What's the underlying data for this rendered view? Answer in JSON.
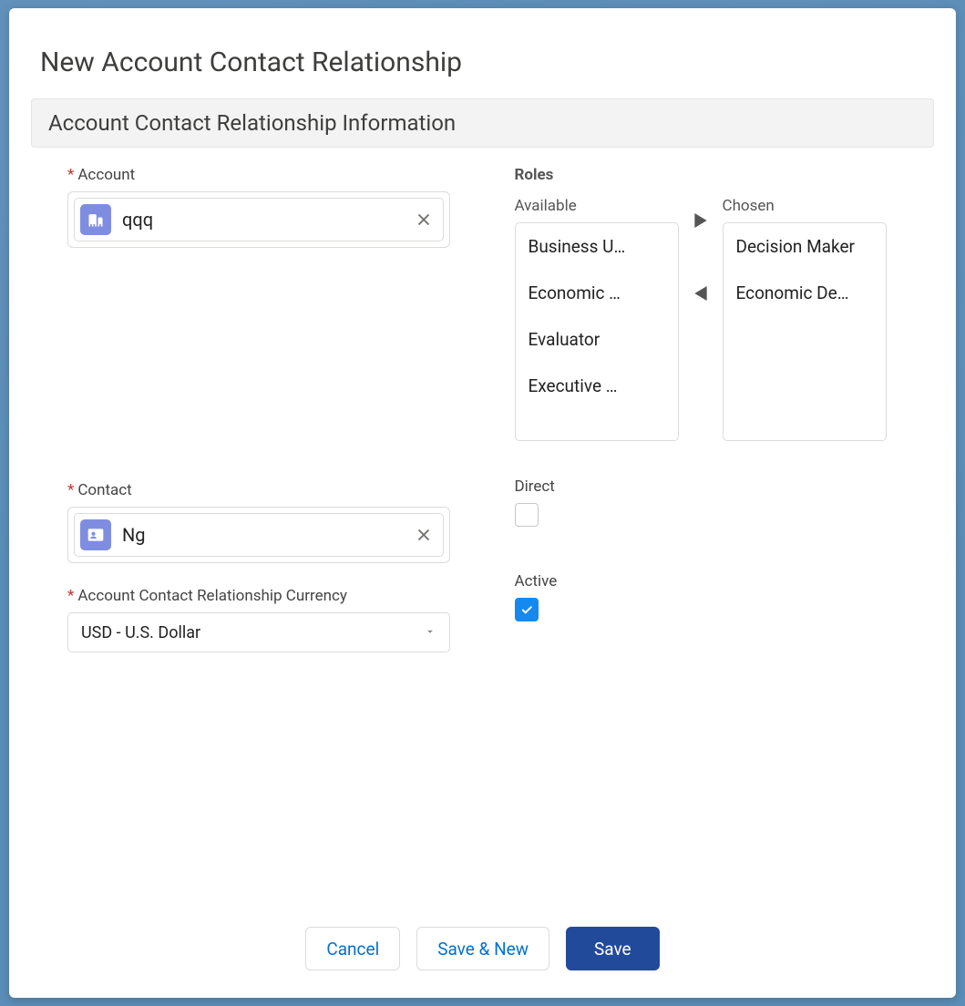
{
  "modal": {
    "title": "New Account Contact Relationship",
    "section_header": "Account Contact Relationship Information"
  },
  "fields": {
    "account": {
      "label": "Account",
      "value": "qqq",
      "required": true
    },
    "contact": {
      "label": "Contact",
      "value": "Ng",
      "required": true
    },
    "currency": {
      "label": "Account Contact Relationship Currency",
      "value": "USD - U.S. Dollar",
      "required": true
    },
    "roles": {
      "label": "Roles",
      "available_label": "Available",
      "chosen_label": "Chosen",
      "available": [
        "Business U…",
        "Economic …",
        "Evaluator",
        "Executive …"
      ],
      "chosen": [
        "Decision Maker",
        "Economic De…"
      ]
    },
    "direct": {
      "label": "Direct",
      "checked": false
    },
    "active": {
      "label": "Active",
      "checked": true
    }
  },
  "buttons": {
    "cancel": "Cancel",
    "save_new": "Save & New",
    "save": "Save"
  }
}
